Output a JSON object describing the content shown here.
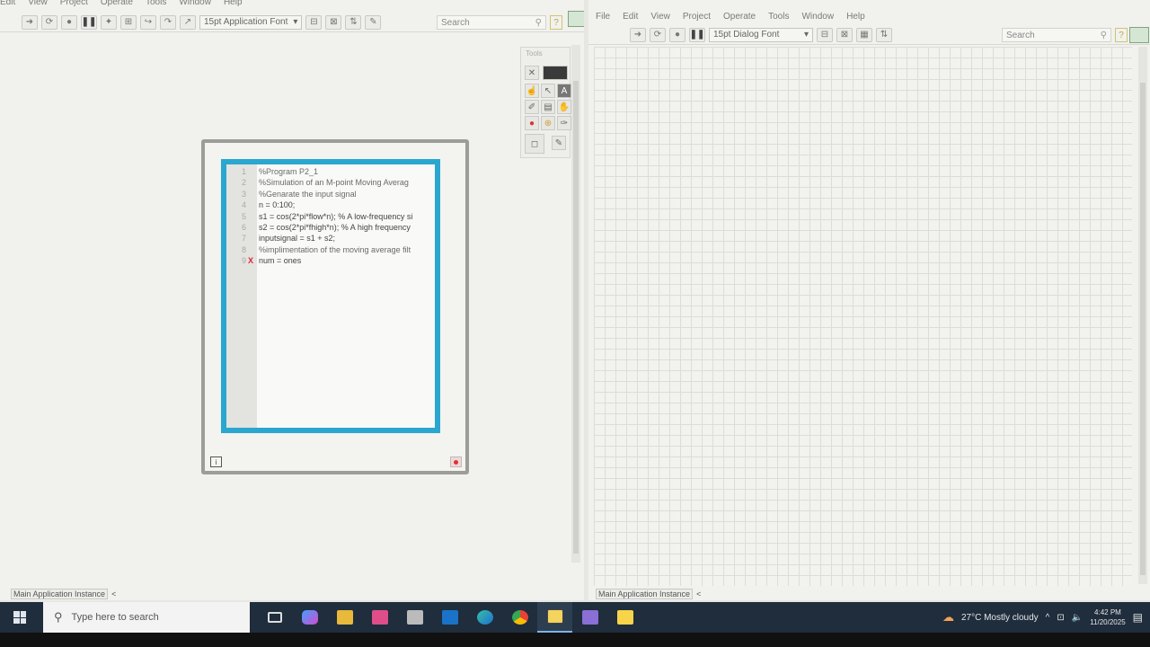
{
  "left_window": {
    "menu": [
      "Edit",
      "View",
      "Project",
      "Operate",
      "Tools",
      "Window",
      "Help"
    ],
    "font_select": "15pt Application Font",
    "search_placeholder": "Search",
    "tools_title": "Tools",
    "status_label": "Main Application Instance",
    "status_arrow": "<",
    "mathscript": {
      "lines": [
        {
          "n": "1",
          "text": "%Program P2_1",
          "comment": true,
          "error": false
        },
        {
          "n": "2",
          "text": "%Simulation of an M-point Moving Averag",
          "comment": true,
          "error": false
        },
        {
          "n": "3",
          "text": "%Genarate the input signal",
          "comment": true,
          "error": false
        },
        {
          "n": "4",
          "text": "n = 0:100;",
          "comment": false,
          "error": false
        },
        {
          "n": "5",
          "text": "s1 = cos(2*pi*flow*n); % A low-frequency si",
          "comment": false,
          "error": false
        },
        {
          "n": "6",
          "text": "s2 = cos(2*pi*fhigh*n); % A high frequency",
          "comment": false,
          "error": false
        },
        {
          "n": "7",
          "text": "inputsignal = s1 + s2;",
          "comment": false,
          "error": false
        },
        {
          "n": "8",
          "text": "%implimentation of the moving average filt",
          "comment": true,
          "error": false
        },
        {
          "n": "9",
          "text": "num = ones",
          "comment": false,
          "error": true
        }
      ],
      "error_marker": "X",
      "iteration_label": "i"
    }
  },
  "right_window": {
    "menu": [
      "File",
      "Edit",
      "View",
      "Project",
      "Operate",
      "Tools",
      "Window",
      "Help"
    ],
    "font_select": "15pt Dialog Font",
    "search_placeholder": "Search",
    "status_label": "Main Application Instance",
    "status_arrow": "<"
  },
  "taskbar": {
    "search_placeholder": "Type here to search",
    "weather": "27°C  Mostly cloudy",
    "time": "4:42 PM",
    "date": "11/20/2025",
    "apps": [
      "task-view",
      "copilot",
      "file-explorer",
      "store",
      "media",
      "outlook",
      "edge",
      "chrome",
      "labview",
      "app-2",
      "sticky-notes"
    ]
  }
}
